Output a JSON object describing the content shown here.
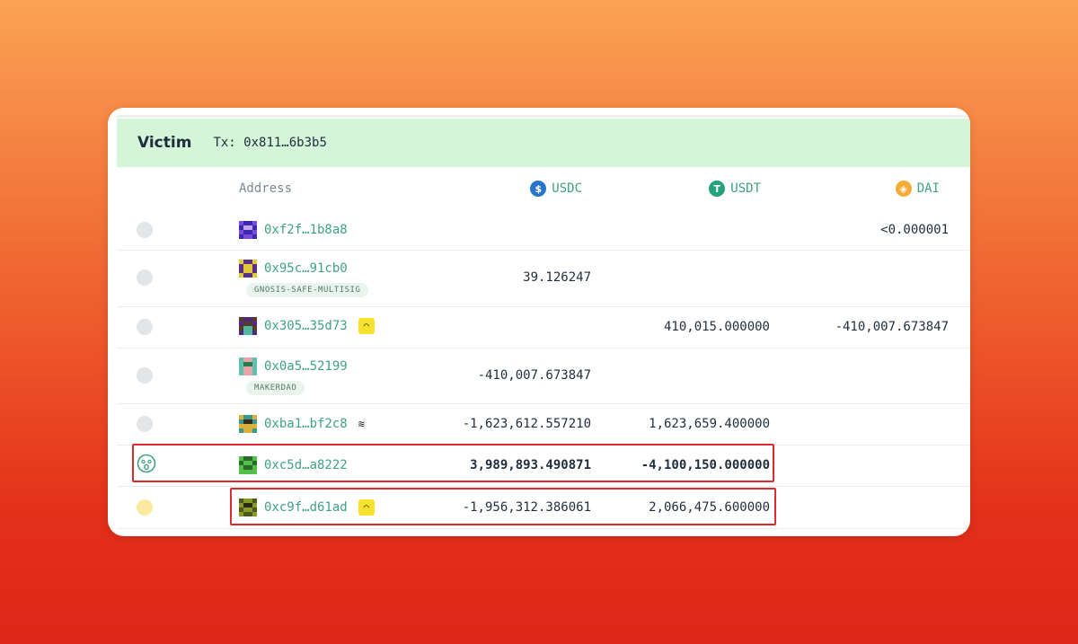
{
  "panel": {
    "title": "Victim",
    "tx_label": "Tx: 0x811…6b3b5"
  },
  "columns": {
    "address": "Address",
    "usdc": "USDC",
    "usdt": "USDT",
    "dai": "DAI"
  },
  "token_icons": {
    "usdc": {
      "glyph": "$",
      "color": "#2775ca"
    },
    "usdt": {
      "glyph": "T",
      "color": "#26a17b"
    },
    "dai": {
      "glyph": "◈",
      "color": "#f5ac37"
    }
  },
  "rows": [
    {
      "address": "0xf2f…1b8a8",
      "tag": "",
      "usdc": "",
      "usdt": "",
      "dai": "<0.000001",
      "status": "grey-dot"
    },
    {
      "address": "0x95c…91cb0",
      "tag": "GNOSIS-SAFE-MULTISIG",
      "usdc": "39.126247",
      "usdt": "",
      "dai": "",
      "status": "grey-dot"
    },
    {
      "address": "0x305…35d73",
      "tag": "",
      "usdc": "",
      "usdt": "410,015.000000",
      "dai": "-410,007.673847",
      "status": "grey-dot",
      "badge": "yellow-pool-icon"
    },
    {
      "address": "0x0a5…52199",
      "tag": "MAKERDAO",
      "usdc": "-410,007.673847",
      "usdt": "",
      "dai": "",
      "status": "grey-dot"
    },
    {
      "address": "0xba1…bf2c8",
      "tag": "",
      "usdc": "-1,623,612.557210",
      "usdt": "1,623,659.400000",
      "dai": "",
      "status": "grey-dot",
      "badge": "stack-icon"
    },
    {
      "address": "0xc5d…a8222",
      "tag": "",
      "usdc": "3,989,893.490871",
      "usdt": "-4,100,150.000000",
      "dai": "",
      "status": "scared-face-icon",
      "bold": true
    },
    {
      "address": "0xc9f…d61ad",
      "tag": "",
      "usdc": "-1,956,312.386061",
      "usdt": "2,066,475.600000",
      "dai": "",
      "status": "yellow-dot",
      "badge": "yellow-pool-icon"
    }
  ],
  "colors": {
    "accent_green": "#3fa382",
    "header_bg": "#d5f5d9",
    "highlight_red": "#dd2a30"
  }
}
